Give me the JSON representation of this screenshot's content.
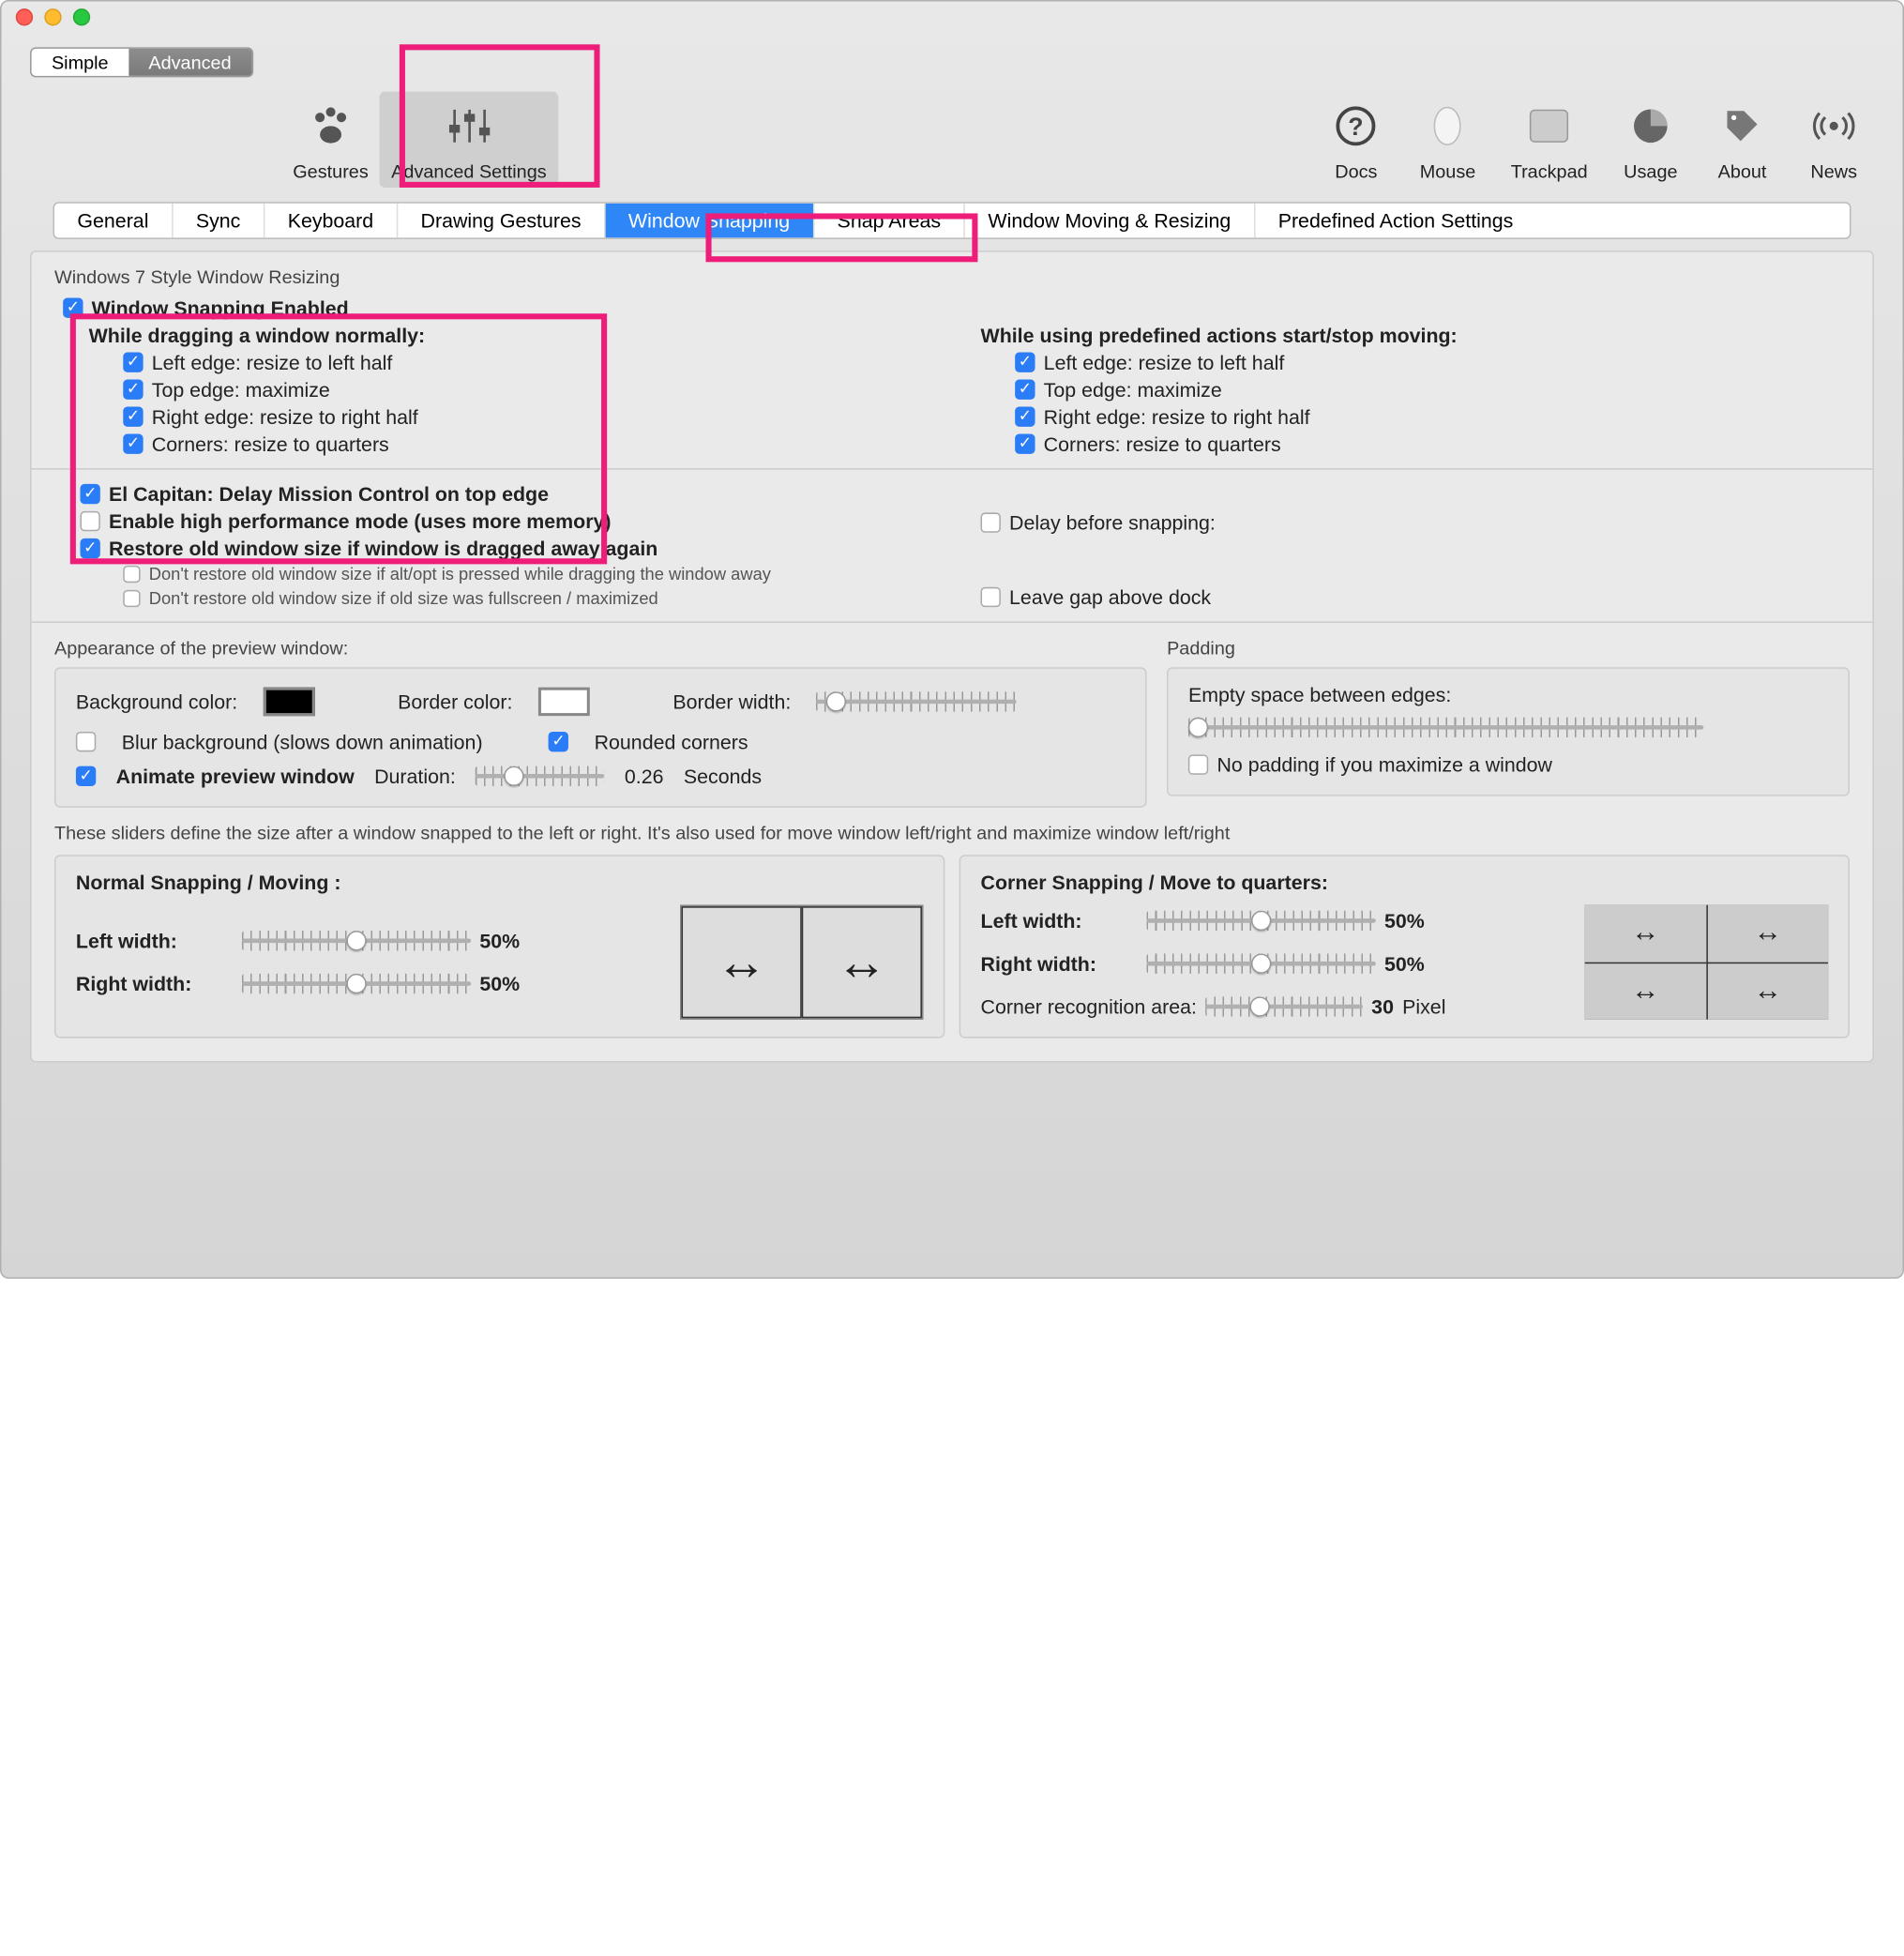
{
  "seg": {
    "simple": "Simple",
    "advanced": "Advanced"
  },
  "toolbar": {
    "gestures": "Gestures",
    "adv": "Advanced Settings"
  },
  "rbar": {
    "docs": "Docs",
    "mouse": "Mouse",
    "trackpad": "Trackpad",
    "usage": "Usage",
    "about": "About",
    "news": "News"
  },
  "tabs": {
    "general": "General",
    "sync": "Sync",
    "keyboard": "Keyboard",
    "drawing": "Drawing Gestures",
    "snap": "Window Snapping",
    "areas": "Snap Areas",
    "move": "Window Moving & Resizing",
    "predef": "Predefined Action Settings"
  },
  "sec1": "Windows 7 Style Window Resizing",
  "enable": "Window Snapping Enabled",
  "dragHeader": "While dragging a window normally:",
  "predefHeader": "While using predefined actions start/stop moving:",
  "opt": {
    "left": "Left edge: resize to left half",
    "top": "Top edge: maximize",
    "right": "Right edge: resize to right half",
    "corners": "Corners: resize to quarters"
  },
  "elcap": "El Capitan: Delay Mission Control on top edge",
  "hiperf": "Enable high performance mode (uses more memory)",
  "restore": "Restore old window size if window is dragged away again",
  "restore_sub1": "Don't restore old window size if alt/opt is pressed while dragging the window away",
  "restore_sub2": "Don't restore old window size if old size was fullscreen / maximized",
  "delay_snap": "Delay before snapping:",
  "gap_dock": "Leave gap above dock",
  "appearance": "Appearance of the preview window:",
  "bgcolor": "Background color:",
  "bordercolor": "Border color:",
  "borderwidth": "Border width:",
  "blurbg": "Blur background (slows down animation)",
  "rounded": "Rounded corners",
  "animate": "Animate preview window",
  "duration": "Duration:",
  "dur_val": "0.26",
  "seconds": "Seconds",
  "padding": "Padding",
  "empty_space": "Empty space between edges:",
  "nopad_max": "No padding if you maximize a window",
  "sliders_desc": "These sliders define the size after a window snapped to the left or right. It's also used for move window left/right and maximize window left/right",
  "normal_title": "Normal Snapping / Moving :",
  "corner_title": "Corner Snapping / Move to quarters:",
  "left_width": "Left width:",
  "right_width": "Right width:",
  "pct50": "50%",
  "cra": "Corner recognition area:",
  "cra_val": "30",
  "pixel": "Pixel"
}
